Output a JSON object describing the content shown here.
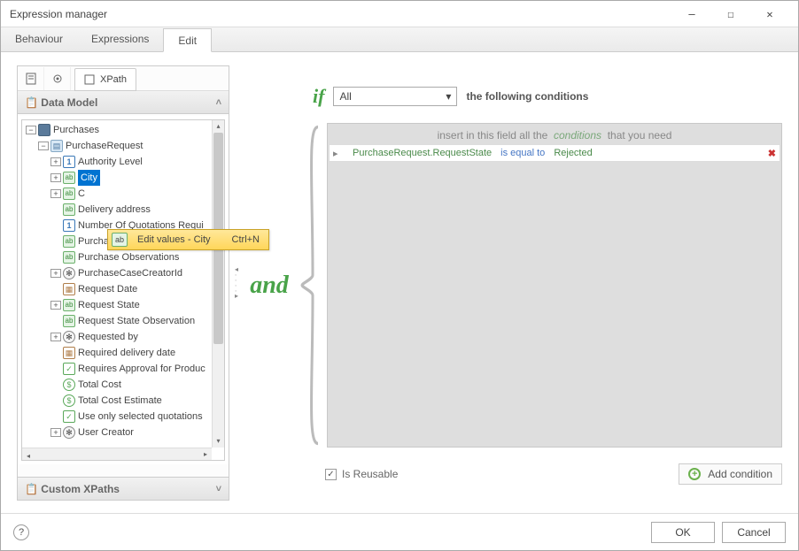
{
  "window": {
    "title": "Expression manager"
  },
  "tabs": {
    "behaviour": "Behaviour",
    "expressions": "Expressions",
    "edit": "Edit"
  },
  "leftPanel": {
    "xpathTab": "XPath",
    "dataModelHeader": "Data Model",
    "customXpathsHeader": "Custom XPaths",
    "tree": {
      "root": "Purchases",
      "entity": "PurchaseRequest",
      "items": [
        "Authority Level",
        "City",
        "C",
        "Delivery address",
        "Number Of Quotations Requi",
        "Purchase justification",
        "Purchase Observations",
        "PurchaseCaseCreatorId",
        "Request Date",
        "Request State",
        "Request State Observation",
        "Requested by",
        "Required delivery date",
        "Requires Approval for Produc",
        "Total Cost",
        "Total Cost Estimate",
        "Use only selected quotations",
        "User Creator"
      ]
    }
  },
  "contextMenu": {
    "label": "Edit values - City",
    "shortcut": "Ctrl+N"
  },
  "expr": {
    "if": "if",
    "comboValue": "All",
    "following": "the following conditions",
    "and": "and",
    "hint_pre": "insert in this field all the",
    "hint_em": "conditions",
    "hint_post": "that you need",
    "condition": {
      "field": "PurchaseRequest.RequestState",
      "op": "is equal to",
      "value": "Rejected"
    },
    "reusable": "Is Reusable",
    "addCondition": "Add condition"
  },
  "footer": {
    "ok": "OK",
    "cancel": "Cancel"
  }
}
